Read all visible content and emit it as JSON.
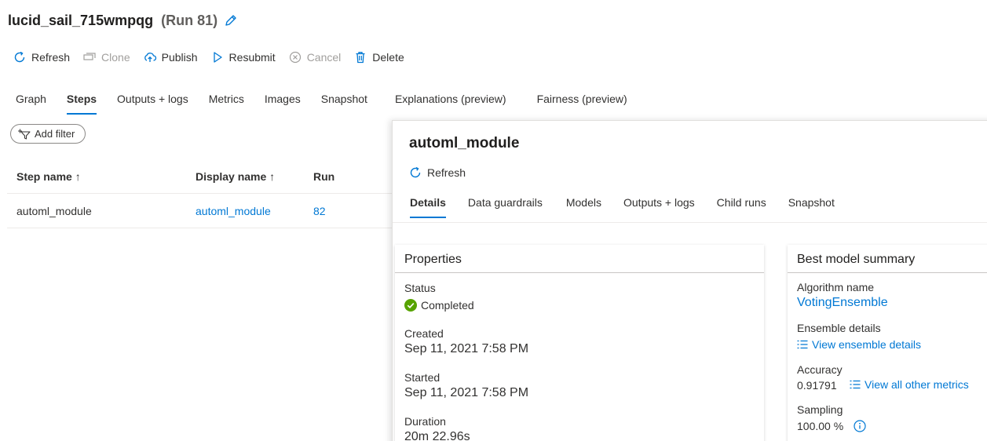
{
  "header": {
    "run_name": "lucid_sail_715wmpqg",
    "run_id": "(Run 81)"
  },
  "toolbar": {
    "refresh": "Refresh",
    "clone": "Clone",
    "publish": "Publish",
    "resubmit": "Resubmit",
    "cancel": "Cancel",
    "delete": "Delete"
  },
  "tabs": {
    "graph": "Graph",
    "steps": "Steps",
    "outputs_logs": "Outputs + logs",
    "metrics": "Metrics",
    "images": "Images",
    "snapshot": "Snapshot",
    "explanations": "Explanations (preview)",
    "fairness": "Fairness (preview)"
  },
  "filter": {
    "add_filter": "Add filter"
  },
  "steps_table": {
    "headers": {
      "step_name": "Step name ↑",
      "display_name": "Display name ↑",
      "run": "Run"
    },
    "rows": [
      {
        "step_name": "automl_module",
        "display_name": "automl_module",
        "run": "82"
      }
    ]
  },
  "panel": {
    "title": "automl_module",
    "refresh": "Refresh",
    "tabs": {
      "details": "Details",
      "data_guardrails": "Data guardrails",
      "models": "Models",
      "outputs_logs": "Outputs + logs",
      "child_runs": "Child runs",
      "snapshot": "Snapshot"
    },
    "properties": {
      "header": "Properties",
      "status_label": "Status",
      "status_value": "Completed",
      "created_label": "Created",
      "created_value": "Sep 11, 2021 7:58 PM",
      "started_label": "Started",
      "started_value": "Sep 11, 2021 7:58 PM",
      "duration_label": "Duration",
      "duration_value": "20m 22.96s"
    },
    "best_model": {
      "header": "Best model summary",
      "algorithm_label": "Algorithm name",
      "algorithm_value": "VotingEnsemble",
      "ensemble_label": "Ensemble details",
      "ensemble_link": "View ensemble details",
      "accuracy_label": "Accuracy",
      "accuracy_value": "0.91791",
      "metrics_link": "View all other metrics",
      "sampling_label": "Sampling",
      "sampling_value": "100.00 %"
    }
  },
  "colors": {
    "accent": "#0078d4",
    "success": "#57a300",
    "disabled": "#a19f9d"
  },
  "icons": [
    "pencil-icon",
    "refresh-icon",
    "clone-icon",
    "cloud-upload-icon",
    "play-icon",
    "cancel-icon",
    "trash-icon",
    "filter-icon",
    "check-circle-icon",
    "list-icon",
    "info-icon"
  ]
}
